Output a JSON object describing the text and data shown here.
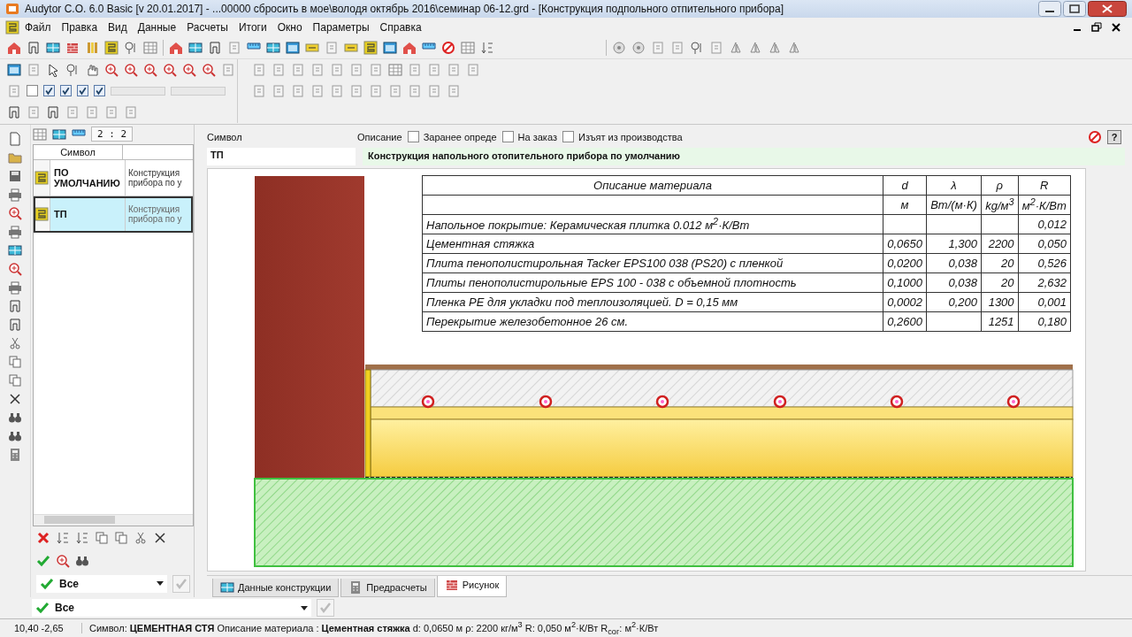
{
  "window": {
    "title": "Audytor C.O. 6.0 Basic [v 20.01.2017] - ...00000 сбросить в мое\\володя октябрь 2016\\семинар 06-12.grd - [Конструкция подпольного отпительного прибора]"
  },
  "menu": [
    "Файл",
    "Правка",
    "Вид",
    "Данные",
    "Расчеты",
    "Итоги",
    "Окно",
    "Параметры",
    "Справка"
  ],
  "toolbar": {
    "checkboxes": [
      {
        "checked": false
      },
      {
        "checked": true
      },
      {
        "checked": true
      },
      {
        "checked": true
      },
      {
        "checked": true
      }
    ]
  },
  "list": {
    "ratio": "2 : 2",
    "columns": [
      "Символ"
    ],
    "rows": [
      {
        "symbol": "ПО УМОЛЧАНИЮ",
        "description_lines": [
          "Конструкция",
          "прибора по у"
        ],
        "selected": false
      },
      {
        "symbol": "ТП",
        "description_lines": [
          "Конструкция",
          "прибора по у"
        ],
        "selected": true
      }
    ],
    "filter": "Все"
  },
  "form": {
    "symbol_label": "Символ",
    "symbol": "ТП",
    "description_label": "Описание",
    "description": "Конструкция напольного отопительного прибора по умолчанию",
    "help": "?",
    "flags": [
      {
        "label": "Заранее опреде",
        "checked": false
      },
      {
        "label": "На заказ",
        "checked": false
      },
      {
        "label": "Изъят из производства",
        "checked": false
      }
    ]
  },
  "materials": {
    "columns": [
      "Описание материала",
      "d",
      "λ",
      "ρ",
      "R"
    ],
    "units": [
      "м",
      "Вт/(м·К)",
      "kg/м$^{3}$",
      "м$^{2}$·К/Вт"
    ],
    "rows": [
      {
        "description": "Напольное покрытие: Керамическая плитка 0.012 м$^{2}$·К/Вт",
        "r": "0,012"
      },
      {
        "description": "Цементная стяжка",
        "d": "0,0650",
        "lambda": "1,300",
        "rho": "2200",
        "r": "0,050"
      },
      {
        "description": "Плита пенополистирольная Tacker EPS100 038 (PS20) с пленкой",
        "d": "0,0200",
        "lambda": "0,038",
        "rho": "20",
        "r": "0,526"
      },
      {
        "description": "Плиты пенополистирольные  EPS 100 - 038 с объемной плотность",
        "d": "0,1000",
        "lambda": "0,038",
        "rho": "20",
        "r": "2,632"
      },
      {
        "description": "Пленка PE для укладки под теплоизоляцией. D = 0,15 мм",
        "d": "0,0002",
        "lambda": "0,200",
        "rho": "1300",
        "r": "0,001"
      },
      {
        "description": "Перекрытие железобетонное 26 см.",
        "d": "0,2600",
        "rho": "1251",
        "r": "0,180"
      }
    ]
  },
  "tabs": [
    {
      "label": "Данные конструкции",
      "selected": false
    },
    {
      "label": "Предрасчеты",
      "selected": false
    },
    {
      "label": "Рисунок",
      "selected": true
    }
  ],
  "bottom_filter": "Все",
  "status_bar": {
    "coordinates": "10,40  -2,65",
    "info": "Символ: **ЦЕМЕНТНАЯ СТЯ**  Описание материала : **Цементная стяжка**   d: 0,0650 м  ρ:  2200 кг/м$^{3}$  R:  0,050 м$^{2}$·К/Вт  R$_{сог}$:      м$^{2}$·К/Вт"
  }
}
